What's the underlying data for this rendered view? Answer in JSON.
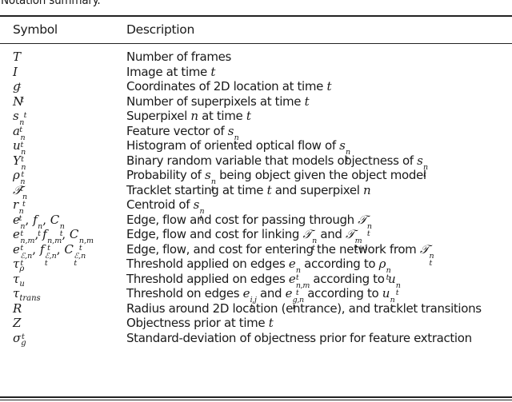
{
  "caption": "Notation summary.",
  "table": {
    "headers": {
      "symbol": "Symbol",
      "description": "Description"
    },
    "rows": [
      {
        "symbol": [
          [
            "i",
            "T"
          ]
        ],
        "description": [
          [
            "t",
            "Number of frames"
          ]
        ]
      },
      {
        "symbol": [
          [
            "i",
            "I"
          ],
          [
            "ss",
            "",
            "t"
          ]
        ],
        "description": [
          [
            "t",
            "Image at time "
          ],
          [
            "i",
            "t"
          ]
        ]
      },
      {
        "symbol": [
          [
            "i",
            "g"
          ],
          [
            "ss",
            "",
            "t"
          ]
        ],
        "description": [
          [
            "t",
            "Coordinates of 2D location at time "
          ],
          [
            "i",
            "t"
          ]
        ]
      },
      {
        "symbol": [
          [
            "i",
            "N"
          ],
          [
            "ss",
            "",
            "t"
          ]
        ],
        "description": [
          [
            "t",
            "Number of superpixels at time "
          ],
          [
            "i",
            "t"
          ]
        ]
      },
      {
        "symbol": [
          [
            "i",
            "s"
          ],
          [
            "ss",
            "n",
            "t"
          ]
        ],
        "description": [
          [
            "t",
            "Superpixel "
          ],
          [
            "i",
            "n"
          ],
          [
            "t",
            " at time "
          ],
          [
            "i",
            "t"
          ]
        ]
      },
      {
        "symbol": [
          [
            "i",
            "a"
          ],
          [
            "ss",
            "n",
            "t"
          ]
        ],
        "description": [
          [
            "t",
            "Feature vector of "
          ],
          [
            "i",
            "s"
          ],
          [
            "ss",
            "n",
            "t"
          ]
        ]
      },
      {
        "symbol": [
          [
            "i",
            "u"
          ],
          [
            "ss",
            "n",
            "t"
          ]
        ],
        "description": [
          [
            "t",
            "Histogram of oriented optical flow of "
          ],
          [
            "i",
            "s"
          ],
          [
            "ss",
            "n",
            "t"
          ]
        ]
      },
      {
        "symbol": [
          [
            "i",
            "Y"
          ],
          [
            "ss",
            "n",
            "t"
          ]
        ],
        "description": [
          [
            "t",
            "Binary random variable that models objectness of "
          ],
          [
            "i",
            "s"
          ],
          [
            "ss",
            "n",
            "t"
          ]
        ]
      },
      {
        "symbol": [
          [
            "i",
            "ρ"
          ],
          [
            "ss",
            "n",
            "t"
          ]
        ],
        "description": [
          [
            "t",
            "Probability of "
          ],
          [
            "i",
            "s"
          ],
          [
            "ss",
            "n",
            "t"
          ],
          [
            "t",
            " being object given the object model"
          ]
        ]
      },
      {
        "symbol": [
          [
            "i",
            "𝒯"
          ],
          [
            "ss",
            "n",
            "t"
          ]
        ],
        "description": [
          [
            "t",
            "Tracklet starting at time "
          ],
          [
            "i",
            "t"
          ],
          [
            "t",
            " and superpixel "
          ],
          [
            "i",
            "n"
          ]
        ]
      },
      {
        "symbol": [
          [
            "i",
            "r"
          ],
          [
            "ss",
            "n",
            "t"
          ]
        ],
        "description": [
          [
            "t",
            "Centroid of "
          ],
          [
            "i",
            "s"
          ],
          [
            "ss",
            "n",
            "t"
          ]
        ]
      },
      {
        "symbol": [
          [
            "i",
            "e"
          ],
          [
            "ss",
            "n",
            "t"
          ],
          [
            "t",
            ", "
          ],
          [
            "i",
            "f"
          ],
          [
            "ss",
            "n",
            "t"
          ],
          [
            "t",
            ", "
          ],
          [
            "i",
            "C"
          ],
          [
            "ss",
            "n",
            "t"
          ]
        ],
        "description": [
          [
            "t",
            "Edge, flow and cost for passing through "
          ],
          [
            "i",
            "𝒯"
          ],
          [
            "ss",
            "n",
            "t"
          ]
        ]
      },
      {
        "symbol": [
          [
            "i",
            "e"
          ],
          [
            "ss",
            "n,m",
            "t"
          ],
          [
            "t",
            ", "
          ],
          [
            "i",
            "f"
          ],
          [
            "ss",
            "n,m",
            "t"
          ],
          [
            "t",
            ", "
          ],
          [
            "i",
            "C"
          ],
          [
            "ss",
            "n,m",
            "t"
          ]
        ],
        "description": [
          [
            "t",
            "Edge, flow and cost for linking "
          ],
          [
            "i",
            "𝒯"
          ],
          [
            "ss",
            "n",
            "t"
          ],
          [
            "t",
            " and "
          ],
          [
            "i",
            "𝒯"
          ],
          [
            "ss",
            "m",
            "t+1"
          ]
        ]
      },
      {
        "symbol": [
          [
            "i",
            "e"
          ],
          [
            "ss",
            "ℰ,n",
            "t"
          ],
          [
            "t",
            ", "
          ],
          [
            "i",
            "f"
          ],
          [
            "ss",
            "ℰ,n",
            "t"
          ],
          [
            "t",
            ", "
          ],
          [
            "i",
            "C"
          ],
          [
            "ss",
            "ℰ,n",
            "t"
          ]
        ],
        "description": [
          [
            "t",
            "Edge, flow, and cost for entering the network from "
          ],
          [
            "i",
            "𝒯"
          ],
          [
            "ss",
            "n",
            "t"
          ]
        ]
      },
      {
        "symbol": [
          [
            "i",
            "τ"
          ],
          [
            "sub",
            "ρ"
          ]
        ],
        "description": [
          [
            "t",
            "Threshold applied on edges "
          ],
          [
            "i",
            "e"
          ],
          [
            "ss",
            "n",
            "t"
          ],
          [
            "t",
            " according to "
          ],
          [
            "i",
            "ρ"
          ],
          [
            "ss",
            "n",
            "t"
          ]
        ]
      },
      {
        "symbol": [
          [
            "i",
            "τ"
          ],
          [
            "sub",
            "u"
          ]
        ],
        "description": [
          [
            "t",
            "Threshold applied on edges "
          ],
          [
            "i",
            "e"
          ],
          [
            "ss",
            "n,m",
            "t"
          ],
          [
            "t",
            " according to "
          ],
          [
            "i",
            "u"
          ],
          [
            "ss",
            "n",
            "t"
          ]
        ]
      },
      {
        "symbol": [
          [
            "i",
            "τ"
          ],
          [
            "sub",
            "trans"
          ]
        ],
        "description": [
          [
            "t",
            "Threshold on edges "
          ],
          [
            "i",
            "e"
          ],
          [
            "ss",
            "i,j",
            "t"
          ],
          [
            "t",
            " and "
          ],
          [
            "i",
            "e"
          ],
          [
            "ss",
            "g,n",
            "t"
          ],
          [
            "t",
            " according to "
          ],
          [
            "i",
            "u"
          ],
          [
            "ss",
            "n",
            "t"
          ]
        ]
      },
      {
        "symbol": [
          [
            "i",
            "R"
          ]
        ],
        "description": [
          [
            "t",
            "Radius around 2D location (entrance), and tracklet transitions"
          ]
        ]
      },
      {
        "symbol": [
          [
            "i",
            "Z"
          ],
          [
            "ss",
            "",
            "t"
          ]
        ],
        "description": [
          [
            "t",
            "Objectness prior at time "
          ],
          [
            "i",
            "t"
          ]
        ]
      },
      {
        "symbol": [
          [
            "i",
            "σ"
          ],
          [
            "sub",
            "g"
          ]
        ],
        "description": [
          [
            "t",
            "Standard-deviation of objectness prior for feature extraction"
          ]
        ]
      }
    ]
  }
}
